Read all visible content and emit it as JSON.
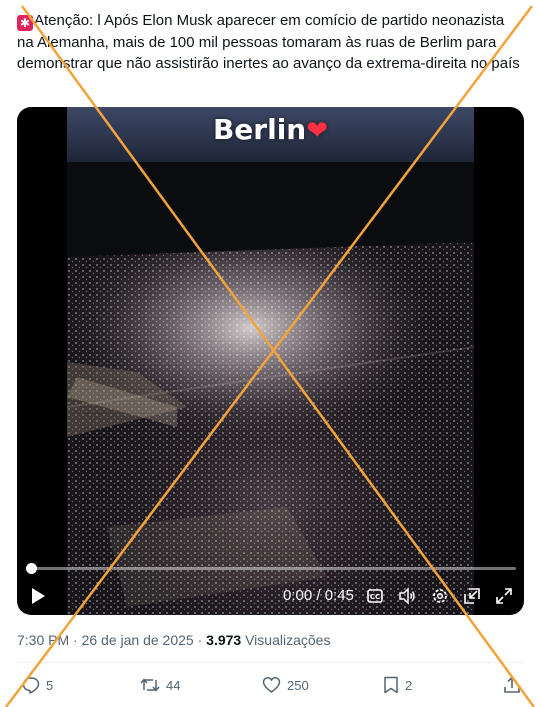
{
  "tweet": {
    "alert_icon": "alert-emoji-icon",
    "text": "Atenção: l Após Elon Musk aparecer em comício de partido neonazista na Alemanha, mais de 100 mil pessoas tomaram às ruas de Berlim para demonstrar que não assistirão inertes ao avanço da extrema-direita no país"
  },
  "video": {
    "caption": "Berlin",
    "caption_emoji": "❤",
    "time": "0:00 / 0:45",
    "progress_fraction": 0.0,
    "controls": [
      "play-icon",
      "captions-icon",
      "volume-icon",
      "settings-icon",
      "pip-icon",
      "fullscreen-icon"
    ]
  },
  "meta": {
    "time": "7:30 PM",
    "sep1": " · ",
    "date": "26 de jan de 2025",
    "sep2": " · ",
    "views": "3.973",
    "views_label": " Visualizações"
  },
  "actions": {
    "replies": "5",
    "retweets": "44",
    "likes": "250",
    "bookmarks": "2"
  },
  "overlay": {
    "mark": "orange-x-crossout",
    "color": "#f2a33a"
  }
}
